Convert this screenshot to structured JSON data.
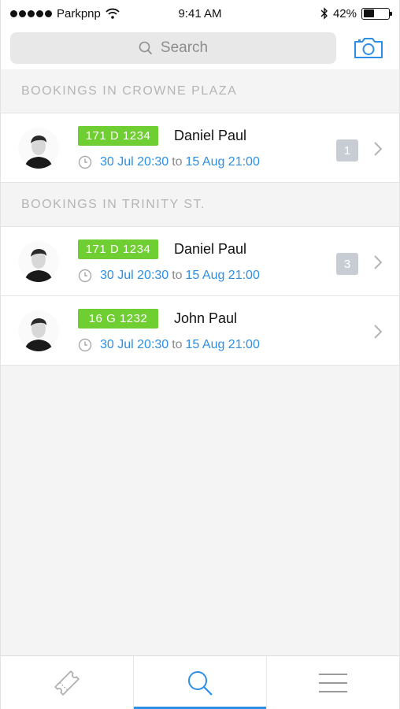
{
  "status_bar": {
    "carrier": "Parkpnp",
    "time": "9:41 AM",
    "battery_percent": "42%",
    "battery_level": 0.42,
    "icons": [
      "signal-dots-icon",
      "wifi-icon",
      "bluetooth-icon",
      "battery-icon"
    ]
  },
  "header": {
    "search_placeholder": "Search",
    "camera_icon": "camera-icon"
  },
  "sections": [
    {
      "title": "BOOKINGS IN CROWNE PLAZA",
      "rows": [
        {
          "plate": "171 D 1234",
          "name": "Daniel Paul",
          "start": "30 Jul 20:30",
          "to": "to",
          "end": "15 Aug 21:00",
          "badge": "1"
        }
      ]
    },
    {
      "title": "BOOKINGS IN TRINITY ST.",
      "rows": [
        {
          "plate": "171 D 1234",
          "name": "Daniel Paul",
          "start": "30 Jul 20:30",
          "to": "to",
          "end": "15 Aug 21:00",
          "badge": "3"
        },
        {
          "plate": "16 G 1232",
          "name": "John Paul",
          "start": "30 Jul 20:30",
          "to": "to",
          "end": "15 Aug 21:00",
          "badge": ""
        }
      ]
    }
  ],
  "tab_bar": {
    "tabs": [
      {
        "icon": "ticket-icon",
        "active": false
      },
      {
        "icon": "search-icon",
        "active": true
      },
      {
        "icon": "menu-icon",
        "active": false
      }
    ]
  },
  "colors": {
    "accent": "#2d8ee6",
    "plate_green": "#6fce32",
    "badge_gray": "#c7cdd3",
    "section_text": "#b5b5b5"
  }
}
